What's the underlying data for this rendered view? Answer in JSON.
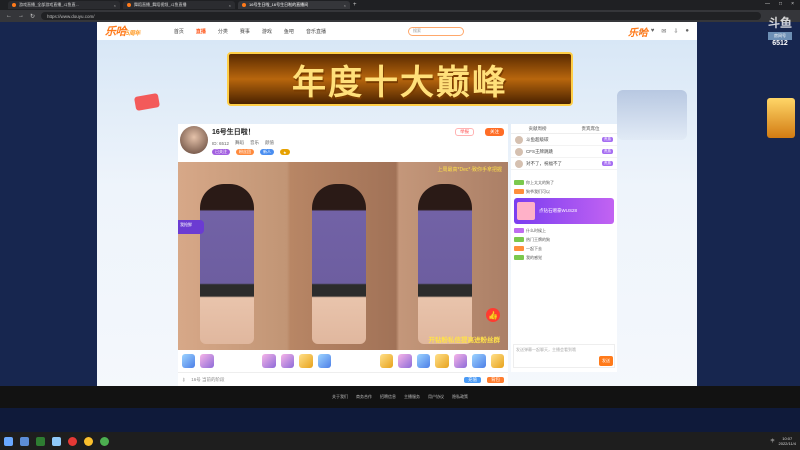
{
  "browser": {
    "tabs": [
      {
        "label": "游戏直播_全部游戏直播_斗鱼直...",
        "close": "×"
      },
      {
        "label": "舞蹈直播_舞蹈视频_斗鱼直播",
        "close": "×"
      },
      {
        "label": "16号生日啦_16号生日啦的直播间",
        "close": "×"
      }
    ],
    "new_tab": "+",
    "window_controls": [
      "—",
      "□",
      "×"
    ],
    "url": "https://www.douyu.com/"
  },
  "site": {
    "logo": "乐哈",
    "logo_sub": "5周年",
    "nav": [
      "首页",
      "直播",
      "分类",
      "赛事",
      "游戏",
      "鱼吧",
      "音乐直播"
    ],
    "search_placeholder": "搜索",
    "top_icons": [
      "history-icon",
      "follow-icon",
      "message-icon",
      "download-icon",
      "user-icon"
    ],
    "right_logo": "乐哈"
  },
  "banner": {
    "text": "年度十大巅峰"
  },
  "player": {
    "title": "16号生日啦！",
    "report": "举报",
    "follow": "关注",
    "meta": [
      "ID: 6512",
      "舞蹈",
      "音乐",
      "颜值"
    ],
    "badges": [
      "已关注",
      "粉丝团",
      "新人"
    ],
    "video_top_text": "上周最高*Dec*·致你手拿把握",
    "video_bottom_text": "开钻粉私信提高进粉丝群",
    "like_icon": "👍",
    "side_tag": "我抢鲜",
    "footer_text": "16号 当前的阶段",
    "charge": "充值",
    "gift": "背包"
  },
  "chat": {
    "tabs": [
      "贡献周榜",
      "贵宾席位"
    ],
    "ranks": [
      {
        "name": "斗鱼超级碳",
        "tag": "贵族"
      },
      {
        "name": "CFS王牌跳跳",
        "tag": "贵族"
      },
      {
        "name": "对不了，祝福不了",
        "tag": "贵族"
      }
    ],
    "messages": [
      {
        "text": "你上太太的狗了"
      },
      {
        "text": "狗爷我们可以"
      },
      {
        "text": "什么时候上"
      },
      {
        "text": "热门王牌的狗"
      },
      {
        "text": "一起下去"
      },
      {
        "text": "我的感觉"
      }
    ],
    "promo": "点钻石赠豪WUS28",
    "input_placeholder": "发送弹幕一起聊天，主播会看到哦",
    "send": "发送"
  },
  "page_footer": [
    "关于我们",
    "商务合作",
    "招聘信息",
    "主播服务",
    "用户协议",
    "隐私政策"
  ],
  "overlay": {
    "title": "斗鱼",
    "label": "房间号",
    "room": "6512"
  },
  "taskbar": {
    "time": "10:07",
    "date": "2022/11/4",
    "lang": "中"
  }
}
